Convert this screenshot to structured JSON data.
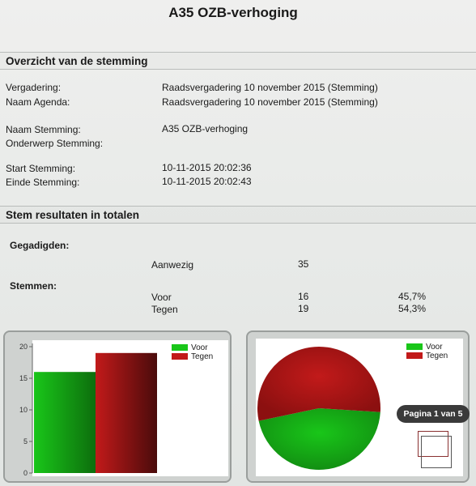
{
  "title": "A35 OZB-verhoging",
  "overview": {
    "header": "Overzicht van de stemming",
    "rows": [
      {
        "label": "Vergadering:",
        "value": "Raadsvergadering 10 november 2015 (Stemming)"
      },
      {
        "label": "Naam Agenda:",
        "value": "Raadsvergadering 10 november 2015 (Stemming)"
      },
      {
        "label": "Naam Stemming:",
        "value": "A35 OZB-verhoging"
      },
      {
        "label": "Onderwerp Stemming:",
        "value": ""
      },
      {
        "label": "Start Stemming:",
        "value": "10-11-2015 20:02:36"
      },
      {
        "label": "Einde Stemming:",
        "value": "10-11-2015 20:02:43"
      }
    ]
  },
  "results": {
    "header": "Stem resultaten in totalen",
    "gegadigden_label": "Gegadigden:",
    "aanwezig": {
      "label": "Aanwezig",
      "count": "35"
    },
    "stemmen_label": "Stemmen:",
    "votes": [
      {
        "label": "Voor",
        "count": "16",
        "pct": "45,7%"
      },
      {
        "label": "Tegen",
        "count": "19",
        "pct": "54,3%"
      }
    ]
  },
  "colors": {
    "voor": "#19c619",
    "tegen": "#c21a1a"
  },
  "chart_data": [
    {
      "type": "bar",
      "categories": [
        "Voor",
        "Tegen"
      ],
      "values": [
        16,
        19
      ],
      "ylim": [
        0,
        20
      ],
      "yticks": [
        "0",
        "5",
        "10",
        "15",
        "20"
      ],
      "legend": [
        "Voor",
        "Tegen"
      ],
      "legend_position": "top-right",
      "grid": false
    },
    {
      "type": "pie",
      "labels": [
        "Voor",
        "Tegen"
      ],
      "values": [
        16,
        19
      ],
      "legend": [
        "Voor",
        "Tegen"
      ],
      "legend_position": "top-right"
    }
  ],
  "pager": {
    "label": "Pagina 1 van 5"
  }
}
